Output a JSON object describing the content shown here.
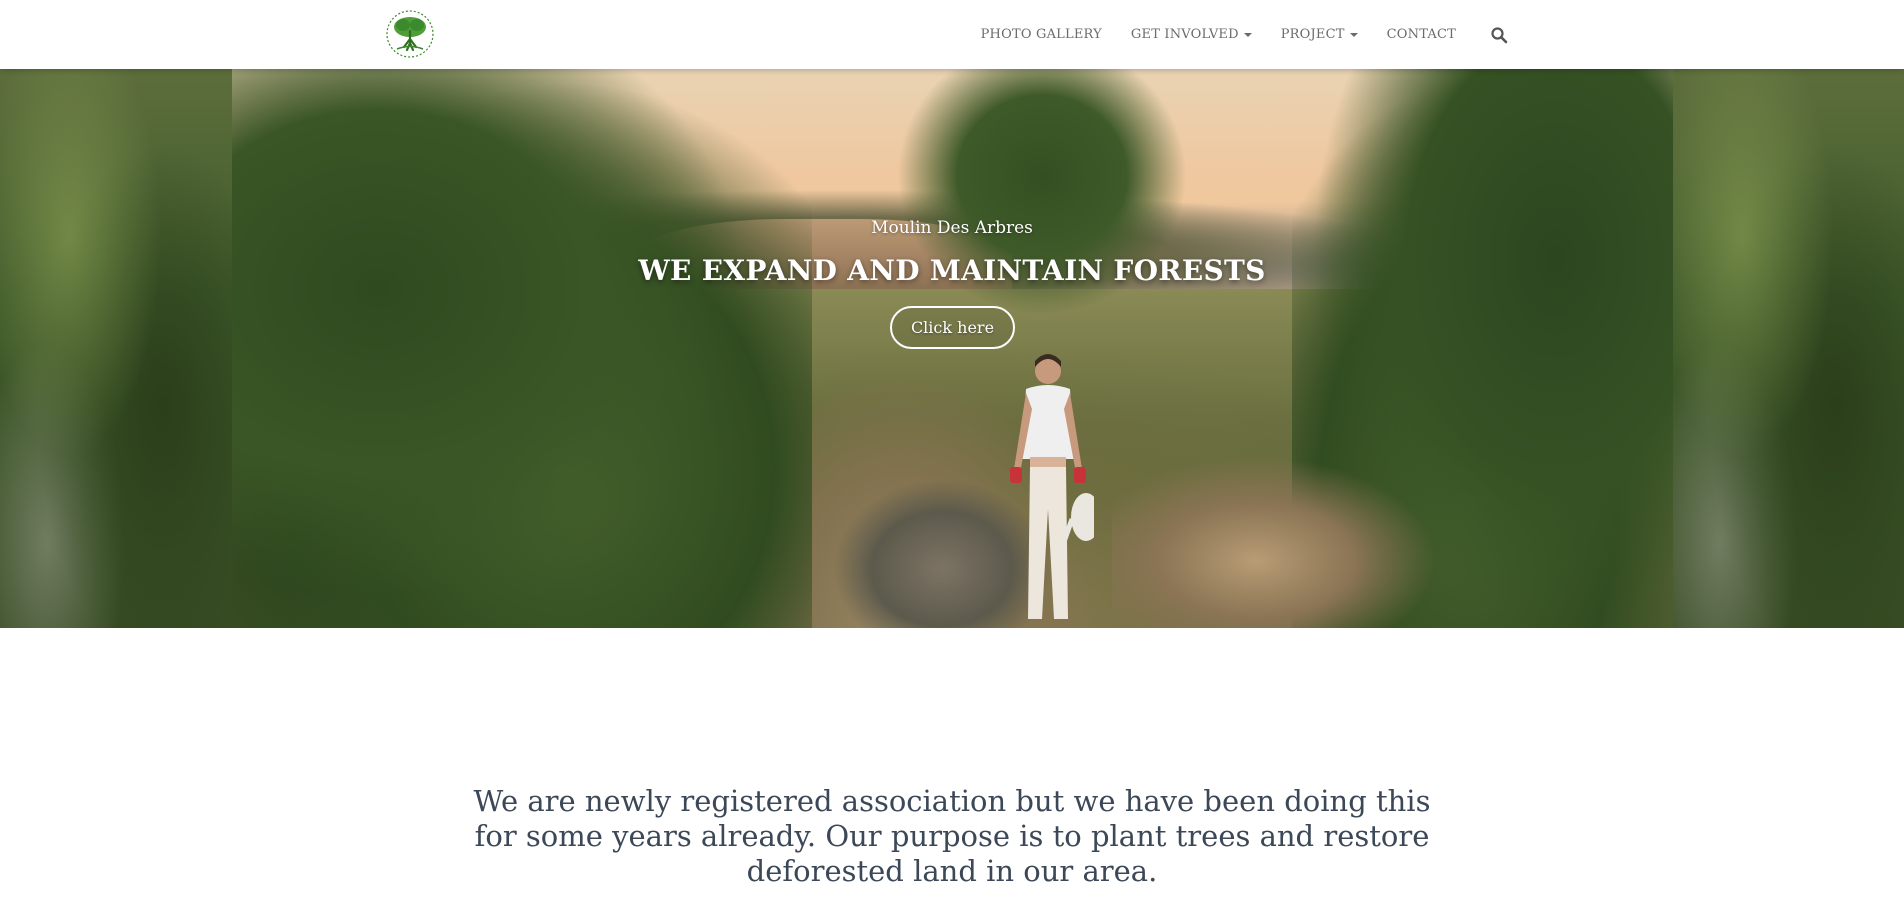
{
  "navbar": {
    "logo_alt": "Moulin Des Arbres tree logo",
    "items": [
      {
        "label": "PHOTO GALLERY",
        "dropdown": false
      },
      {
        "label": "GET INVOLVED",
        "dropdown": true
      },
      {
        "label": "PROJECT",
        "dropdown": true
      },
      {
        "label": "CONTACT",
        "dropdown": false
      }
    ],
    "search_icon": "search-icon"
  },
  "hero": {
    "subtitle": "Moulin Des Arbres",
    "title": "WE EXPAND AND MAINTAIN FORESTS",
    "button_label": "Click here"
  },
  "intro": {
    "text": "We are newly registered association but we have been doing this for some years already. Our purpose is to plant trees and restore deforested land in our area."
  },
  "colors": {
    "nav_text": "#6b6b6b",
    "intro_text": "#3c4858",
    "logo_green": "#3b8a2e"
  }
}
